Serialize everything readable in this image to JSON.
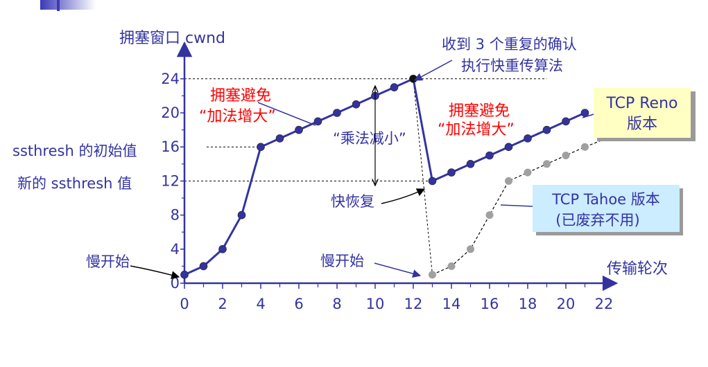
{
  "chart_data": {
    "type": "line",
    "ylabel": "拥塞窗口 cwnd",
    "xlabel": "传输轮次",
    "x_ticks": [
      "0",
      "2",
      "4",
      "6",
      "8",
      "10",
      "12",
      "14",
      "16",
      "18",
      "20",
      "22"
    ],
    "y_ticks": [
      "0",
      "4",
      "8",
      "12",
      "16",
      "20",
      "24"
    ],
    "xlim": [
      0,
      22
    ],
    "ylim": [
      0,
      24
    ],
    "colors": {
      "reno": "#3333a0",
      "tahoe": "#a0a0a0",
      "axis": "#3333a0",
      "red": "#ff0000"
    },
    "series": [
      {
        "key": "reno",
        "x": [
          0,
          1,
          2,
          3,
          4,
          5,
          6,
          7,
          8,
          9,
          10,
          11,
          12,
          13,
          14,
          15,
          16,
          17,
          18,
          19,
          20,
          21
        ],
        "y": [
          1,
          2,
          4,
          8,
          16,
          17,
          18,
          19,
          20,
          21,
          22,
          23,
          24,
          12,
          13,
          14,
          15,
          16,
          17,
          18,
          19,
          20
        ]
      },
      {
        "key": "tahoe",
        "x": [
          13,
          14,
          15,
          16,
          17,
          18,
          19,
          20,
          21
        ],
        "y": [
          1,
          2,
          4,
          8,
          12,
          13,
          14,
          15,
          16
        ]
      }
    ],
    "labels": {
      "ssthresh_init": "ssthresh 的初始值",
      "ssthresh_new": "新的 ssthresh 值",
      "slow_start_1": "慢开始",
      "slow_start_2": "慢开始",
      "ca1_line1": "拥塞避免",
      "ca1_line2": "“加法增大”",
      "ca2_line1": "拥塞避免",
      "ca2_line2": "“加法增大”",
      "md": "“乘法减小”",
      "fast_recovery": "快恢复",
      "dupack_line1": "收到 3 个重复的确认",
      "dupack_line2": "执行快重传算法",
      "reno_line1": "TCP Reno",
      "reno_line2": "版本",
      "tahoe_line1": "TCP Tahoe 版本",
      "tahoe_line2": "(已废弃不用)"
    }
  }
}
